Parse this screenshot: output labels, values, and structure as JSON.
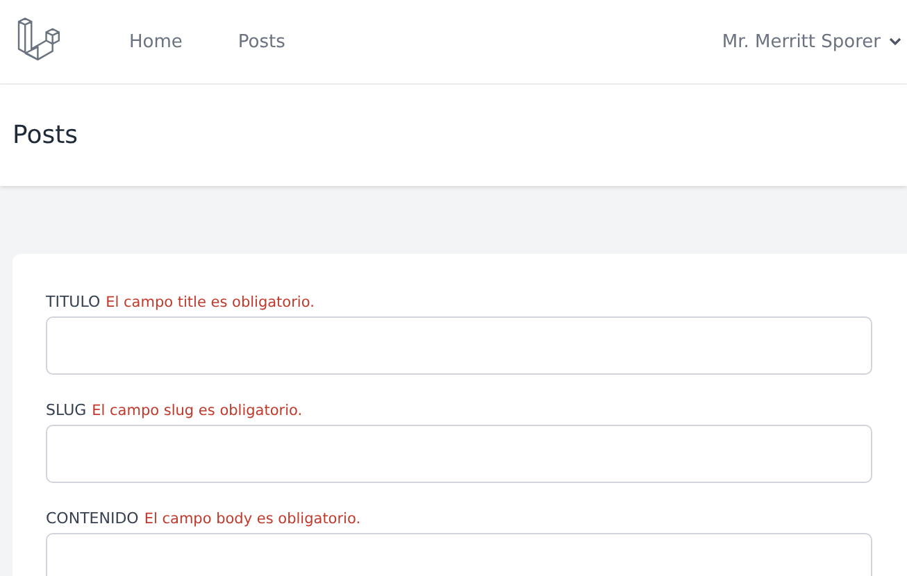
{
  "nav": {
    "links": [
      {
        "label": "Home"
      },
      {
        "label": "Posts"
      }
    ],
    "user": "Mr. Merritt Sporer"
  },
  "header": {
    "title": "Posts"
  },
  "form": {
    "fields": [
      {
        "label": "TITULO",
        "error": "El campo title es obligatorio."
      },
      {
        "label": "SLUG",
        "error": "El campo slug es obligatorio."
      },
      {
        "label": "CONTENIDO",
        "error": "El campo body es obligatorio."
      }
    ]
  }
}
